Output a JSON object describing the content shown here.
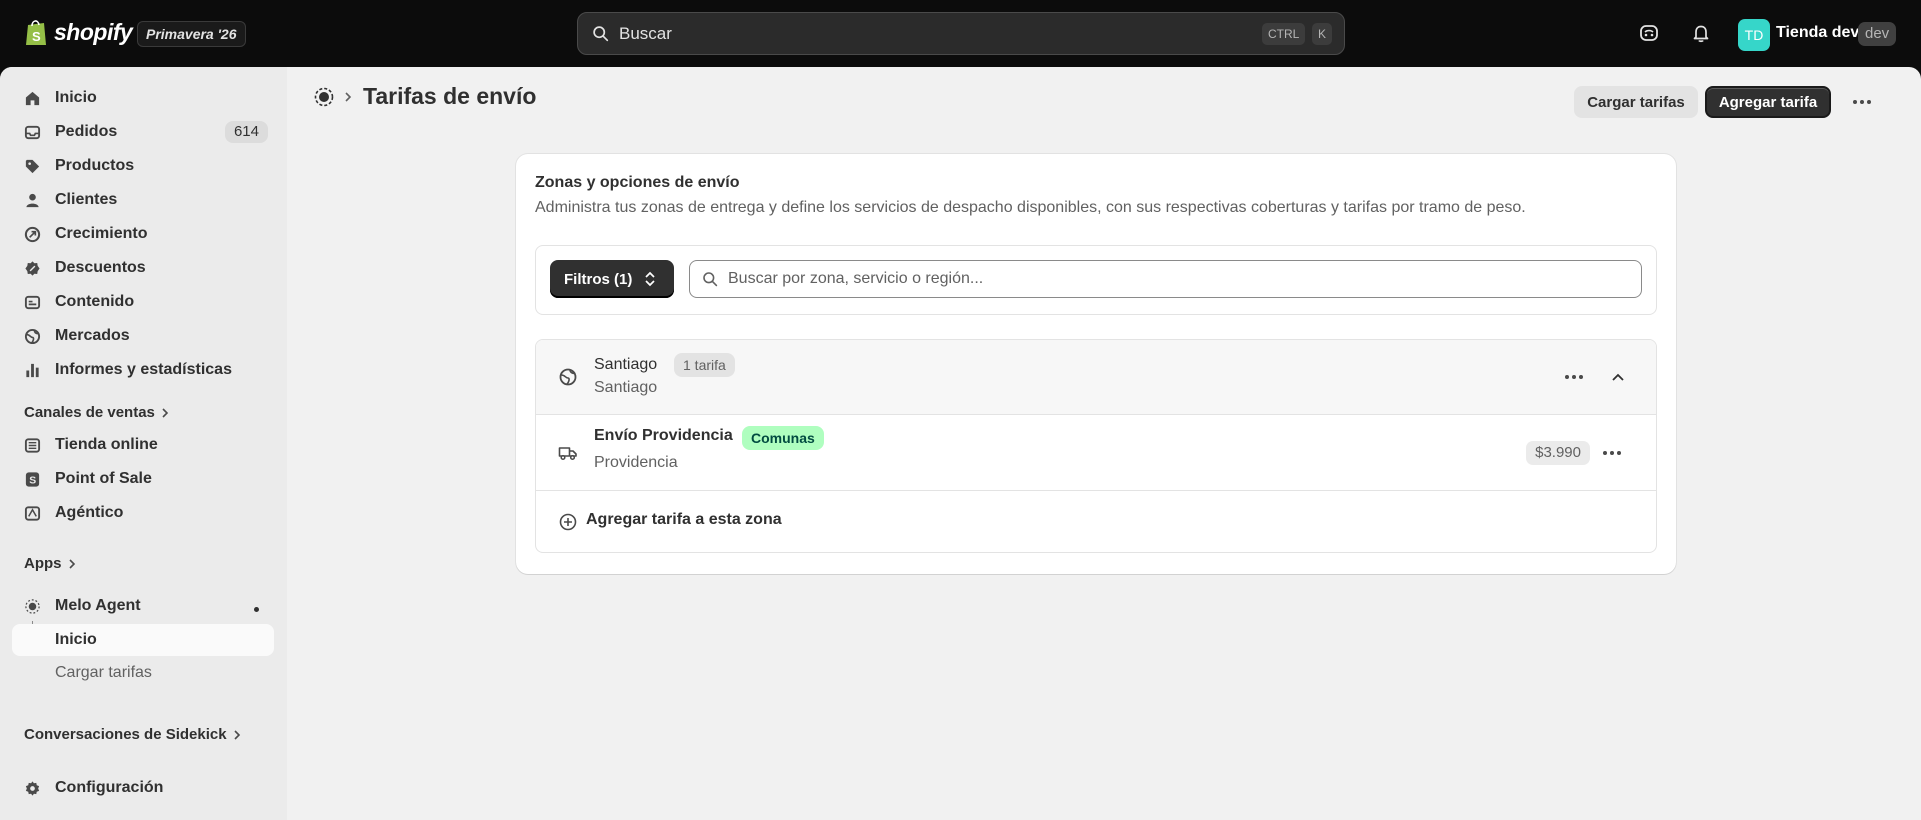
{
  "topbar": {
    "logo_text": "shopify",
    "season_badge": "Primavera '26",
    "search_placeholder": "Buscar",
    "shortcut_key1": "CTRL",
    "shortcut_key2": "K",
    "avatar_initials": "TD",
    "store_name": "Tienda dev",
    "env_badge": "dev"
  },
  "sidebar": {
    "items": [
      {
        "label": "Inicio",
        "icon": "home-icon"
      },
      {
        "label": "Pedidos",
        "icon": "orders-icon",
        "count": "614"
      },
      {
        "label": "Productos",
        "icon": "tag-icon"
      },
      {
        "label": "Clientes",
        "icon": "person-icon"
      },
      {
        "label": "Crecimiento",
        "icon": "growth-icon"
      },
      {
        "label": "Descuentos",
        "icon": "discount-icon"
      },
      {
        "label": "Contenido",
        "icon": "content-icon"
      },
      {
        "label": "Mercados",
        "icon": "globe-icon"
      },
      {
        "label": "Informes y estadísticas",
        "icon": "chart-icon"
      }
    ],
    "sales_channels_label": "Canales de ventas",
    "channels": [
      {
        "label": "Tienda online",
        "icon": "store-icon"
      },
      {
        "label": "Point of Sale",
        "icon": "pos-icon"
      },
      {
        "label": "Agéntico",
        "icon": "agentic-icon"
      }
    ],
    "apps_label": "Apps",
    "app": {
      "label": "Melo Agent",
      "icon": "melo-agent-icon"
    },
    "app_subitems": [
      "Inicio",
      "Cargar tarifas"
    ],
    "sidekick_label": "Conversaciones de Sidekick",
    "settings_label": "Configuración"
  },
  "page": {
    "title": "Tarifas de envío",
    "load_button": "Cargar tarifas",
    "add_button": "Agregar tarifa"
  },
  "card": {
    "title": "Zonas y opciones de envío",
    "description": "Administra tus zonas de entrega y define los servicios de despacho disponibles, con sus respectivas coberturas y tarifas por tramo de peso.",
    "filter_button": "Filtros (1)",
    "search_placeholder": "Buscar por zona, servicio o región...",
    "zone": {
      "name": "Santiago",
      "rate_count": "1 tarifa",
      "region": "Santiago",
      "rate": {
        "name": "Envío Providencia",
        "tag": "Comunas",
        "subtitle": "Providencia",
        "price": "$3.990"
      },
      "add_rate_label": "Agregar tarifa a esta zona"
    }
  },
  "colors": {
    "topbar_bg": "#0c0c0c",
    "primary_button": "#303030",
    "avatar": "#36d6c9",
    "success_badge": "#affebf"
  }
}
